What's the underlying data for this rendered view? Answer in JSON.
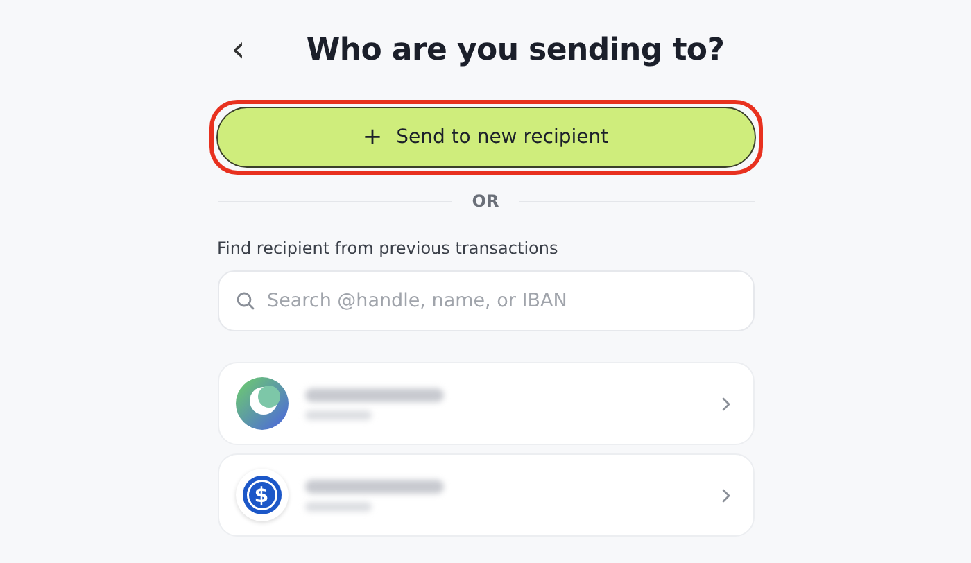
{
  "header": {
    "back": "‹",
    "title": "Who are you sending to?"
  },
  "new_recipient_button": {
    "icon": "+",
    "label": "Send to new recipient",
    "highlighted": true
  },
  "divider": "OR",
  "search": {
    "label": "Find recipient from previous transactions",
    "placeholder": "Search @handle, name, or IBAN"
  },
  "recipients": [
    {
      "kind": "gradient"
    },
    {
      "kind": "coin",
      "symbol": "$"
    }
  ]
}
